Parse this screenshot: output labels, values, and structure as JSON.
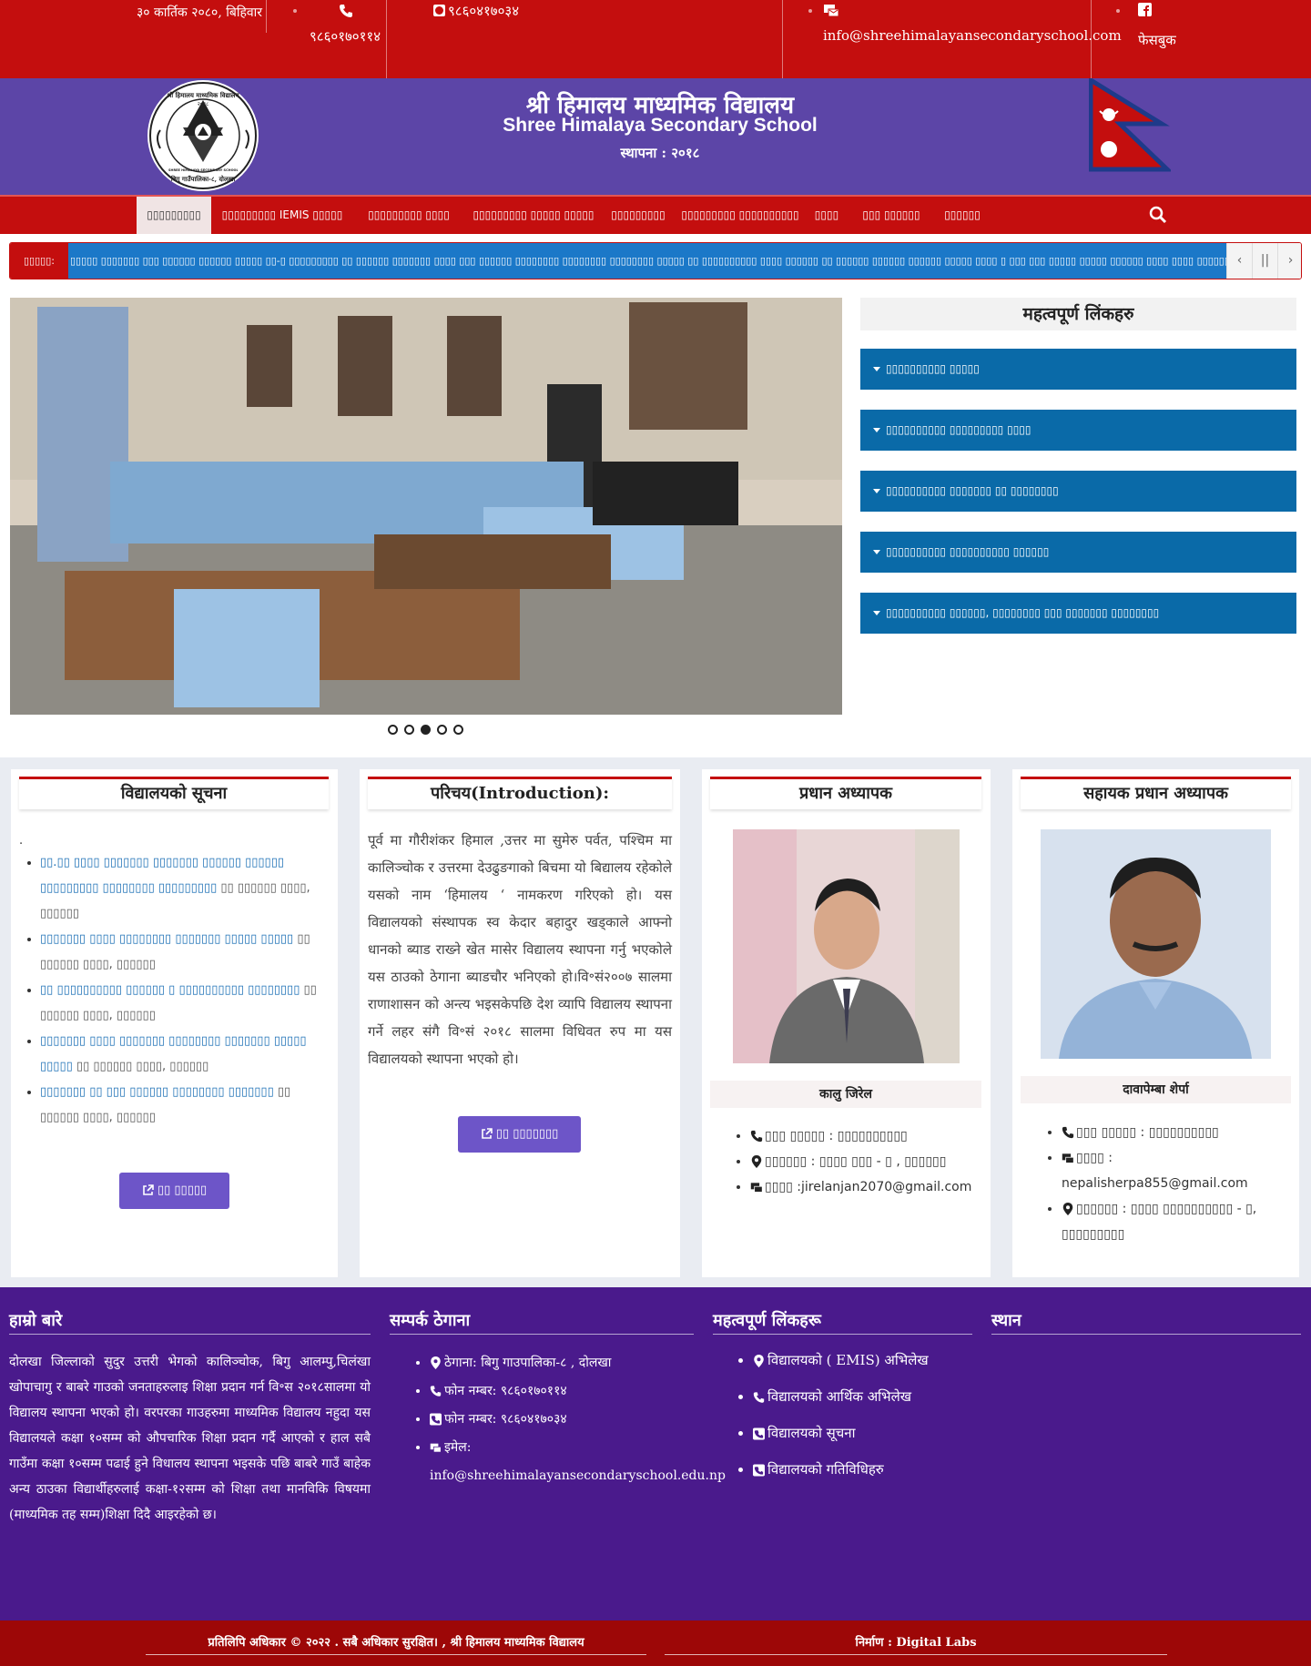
{
  "colors": {
    "topbar": "#c40e0e",
    "header": "#5c45a7",
    "nav": "#c40e0e",
    "link_button": "#0a6aa8",
    "ticker": "#1b78c8",
    "footer": "#4a1a8c",
    "copyright": "#9d0707",
    "accent_button": "#6d55c8"
  },
  "topbar": {
    "date": "३० कार्तिक २०८०, बिहिवार",
    "phone1": "९८६०१७०११४",
    "phone2": "९८६०४१७०३४",
    "email": "info@shreehimalayansecondaryschool.com",
    "facebook": "फेसबुक",
    "icons": [
      "phone-icon",
      "whatsapp-icon",
      "email-icon",
      "facebook-icon"
    ]
  },
  "header": {
    "title_np": "श्री हिमालय माध्यमिक विद्यालय",
    "title_en": "Shree Himalaya Secondary School",
    "established": "स्थापना : २०१८",
    "logo": {
      "top_text": "श्री हिमालय माध्यमिक विद्यालय",
      "year": "२०१८",
      "ring_text": "SHREE HIMALAYA SECONDARY SCHOOL",
      "bottom_text": "बिगु गाउँपालिका-८, दोलखा"
    }
  },
  "nav": {
    "items": [
      "▯▯▯▯▯▯▯▯▯",
      "▯▯▯▯▯▯▯▯▯ IEMIS ▯▯▯▯▯",
      "▯▯▯▯▯▯▯▯▯ ▯▯▯▯",
      "▯▯▯▯▯▯▯▯▯ ▯▯▯▯▯ ▯▯▯▯▯",
      "▯▯▯▯▯▯▯▯▯",
      "▯▯▯▯▯▯▯▯▯ ▯▯▯▯▯▯▯▯▯▯",
      "▯▯▯▯",
      "▯▯▯ ▯▯▯▯▯▯",
      "▯▯▯▯▯▯"
    ],
    "search_icon": "search-icon"
  },
  "ticker": {
    "label": "▯▯▯▯▯:",
    "text": "▯▯▯▯▯ ▯▯▯▯▯▯▯ ▯▯▯ ▯▯▯▯▯▯ ▯▯▯▯▯▯ ▯▯▯▯▯ ▯▯-▯ ▯▯▯▯▯▯▯▯▯ ▯▯ ▯▯▯▯▯▯ ▯▯▯▯▯▯▯ ▯▯▯▯ ▯▯▯ ▯▯▯▯▯▯ ▯▯▯▯▯▯▯▯ ▯▯▯▯▯▯▯▯ ▯▯▯▯▯▯▯▯ ▯▯▯▯▯ ▯▯ ▯▯▯▯▯▯▯▯▯▯ ▯▯▯▯ ▯▯▯▯▯▯ ▯▯ ▯▯▯▯▯▯ ▯▯▯▯▯▯ ▯▯▯▯▯▯ ▯▯▯▯▯ ▯▯▯▯ ▯ ▯▯▯ ▯▯▯ ▯▯▯▯▯ ▯▯▯▯▯ ▯▯▯▯▯▯ ▯▯▯▯ ▯▯▯▯ ▯▯▯▯▯▯▯",
    "prev": "‹",
    "pause": "||",
    "next": "›"
  },
  "slider": {
    "dots": 5,
    "active_dot": 2
  },
  "important_links": {
    "title": "महत्वपूर्ण लिंकहरु",
    "items": [
      "▯▯▯▯▯▯▯▯▯▯ ▯▯▯▯▯",
      "▯▯▯▯▯▯▯▯▯▯ ▯▯▯▯▯▯▯▯▯ ▯▯▯▯",
      "▯▯▯▯▯▯▯▯▯▯ ▯▯▯▯▯▯▯ ▯▯ ▯▯▯▯▯▯▯▯",
      "▯▯▯▯▯▯▯▯▯▯ ▯▯▯▯▯▯▯▯▯▯ ▯▯▯▯▯▯",
      "▯▯▯▯▯▯▯▯▯▯ ▯▯▯▯▯▯, ▯▯▯▯▯▯▯▯ ▯▯▯ ▯▯▯▯▯▯▯ ▯▯▯▯▯▯▯▯"
    ]
  },
  "notices": {
    "title": "विद्यालयको सूचना",
    "items": [
      {
        "link": "▯▯.▯▯ ▯▯▯▯ ▯▯▯▯▯▯▯ ▯▯▯▯▯▯▯ ▯▯▯▯▯▯ ▯▯▯▯▯▯ ▯▯▯▯▯▯▯▯▯ ▯▯▯▯▯▯▯▯ ▯▯▯▯▯▯▯▯▯",
        "rest": "▯▯ ▯▯▯▯▯▯ ▯▯▯▯, ▯▯▯▯▯▯"
      },
      {
        "link": "▯▯▯▯▯▯▯ ▯▯▯▯ ▯▯▯▯▯▯▯▯ ▯▯▯▯▯▯▯ ▯▯▯▯▯ ▯▯▯▯▯",
        "rest": "▯▯ ▯▯▯▯▯▯ ▯▯▯▯, ▯▯▯▯▯▯"
      },
      {
        "link": "▯▯ ▯▯▯▯▯▯▯▯▯▯ ▯▯▯▯▯▯ ▯ ▯▯▯▯▯▯▯▯▯▯ ▯▯▯▯▯▯▯▯",
        "rest": "▯▯ ▯▯▯▯▯▯ ▯▯▯▯, ▯▯▯▯▯▯"
      },
      {
        "link": "▯▯▯▯▯▯▯ ▯▯▯▯ ▯▯▯▯▯▯▯ ▯▯▯▯▯▯▯▯ ▯▯▯▯▯▯▯ ▯▯▯▯▯ ▯▯▯▯▯",
        "rest": "▯▯ ▯▯▯▯▯▯ ▯▯▯▯, ▯▯▯▯▯▯"
      },
      {
        "link": "▯▯▯▯▯▯▯ ▯▯ ▯▯▯ ▯▯▯▯▯▯ ▯▯▯▯▯▯▯▯ ▯▯▯▯▯▯▯",
        "rest": "▯▯ ▯▯▯▯▯▯ ▯▯▯▯, ▯▯▯▯▯▯"
      }
    ],
    "button": "▯▯ ▯▯▯▯▯"
  },
  "intro": {
    "title": "परिचय(Introduction):",
    "text": "पूर्व मा गौरीशंकर हिमाल ,उत्तर मा सुमेरु पर्वत,  पश्चिम मा कालिञ्चोक र उत्तरमा देउढुङगाको बिचमा यो बिद्यालय रहेकोले यसको नाम ‘हिमालय ‘ नामकरण गरिएको हो। यस विद्यालयको संस्थापक स्व केदार बहादुर खड्काले आफ्नो धानको ब्याड राख्ने खेत मासेर विद्यालय स्थापना गर्नु भएकोले यस ठाउको ठेगाना ब्याडचौर भनिएको हो।वि॰सं२००७ सालमा राणाशासन को अन्त्य भइसकेपछि देश व्यापि विद्यालय स्थापना गर्ने लहर संगै वि॰सं २०१८ सालमा विधिवत रुप मा यस विद्यालयको स्थापना भएको हो।",
    "button": "▯▯ ▯▯▯▯▯▯▯"
  },
  "principal": {
    "title": "प्रधान अध्यापक",
    "name": "कालु जिरेल",
    "phone": "▯▯▯ ▯▯▯▯▯ : ▯▯▯▯▯▯▯▯▯▯",
    "address": "▯▯▯▯▯▯ : ▯▯▯▯ ▯▯▯ - ▯ , ▯▯▯▯▯▯",
    "email": "▯▯▯▯ :jirelanjan2070@gmail.com"
  },
  "vice_principal": {
    "title": "सहायक प्रधान अध्यापक",
    "name": "दावापेम्बा शेर्पा",
    "phone": "▯▯▯ ▯▯▯▯▯ : ▯▯▯▯▯▯▯▯▯▯",
    "email_label": "▯▯▯▯ :",
    "email": "nepalisherpa855@gmail.com",
    "address": "▯▯▯▯▯▯ : ▯▯▯▯ ▯▯▯▯▯▯▯▯▯▯ - ▯,",
    "address2": "▯▯▯▯▯▯▯▯▯"
  },
  "footer": {
    "about_title": "हाम्रो बारे",
    "about_text": "दोलखा जिल्लाको सुदुर उत्तरी भेगको कालिञ्चोक, बिगु आलम्पु,चिलंखा खोपाचागु र बाबरे गाउको जनताहरुलाइ शिक्षा प्रदान गर्न वि॰स २०१८सालमा यो विद्यालय स्थापना भएको हो। वरपरका गाउहरुमा माध्यमिक विद्यालय नहुदा यस विद्यालयले कक्षा १०सम्म को औपचारिक शिक्षा प्रदान गर्दै आएको र हाल सबै गाउँमा कक्षा १०सम्म पढाई हुने विधालय स्थापना भइसके पछि बाबरे गाउँ बाहेक अन्य ठाउका विद्यार्थीहरुलाई कक्षा-१२सम्म को शिक्षा तथा मानविकि विषयमा (माध्यमिक तह सम्म)शिक्षा दिदै आइरहेको छ।",
    "contact_title": "सम्पर्क ठेगाना",
    "contact": {
      "address": "ठेगाना: बिगु गाउपालिका-८ , दोलखा",
      "phone1": "फोन नम्बर: ९८६०१७०११४",
      "phone2": "फोन नम्बर: ९८६०४१७०३४",
      "email_label": "इमेल:",
      "email": "info@shreehimalayansecondaryschool.edu.np"
    },
    "links_title": "महत्वपूर्ण लिंकहरू",
    "links": [
      "विद्यालयको ( EMIS) अभिलेख",
      "विद्यालयको आर्थिक अभिलेख",
      "विद्यालयको सूचना",
      "विद्यालयको गतिविधिहरु"
    ],
    "location_title": "स्थान"
  },
  "copyright": {
    "text": "प्रतिलिपि अधिकार © २०२२ . सबै अधिकार सुरक्षित। , श्री हिमालय माध्यमिक विद्यालय",
    "credit": "निर्माण : Digital Labs"
  }
}
